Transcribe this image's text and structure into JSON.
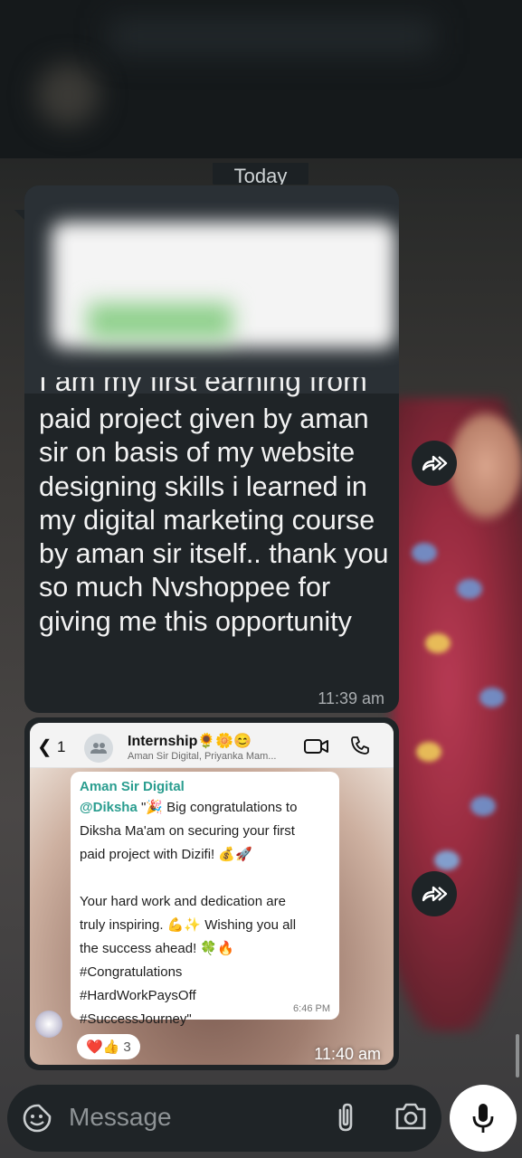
{
  "date_chip": "Today",
  "message": {
    "cut_line": "I am my first earning from",
    "text": "paid project given by aman sir on basis of my website designing skills i learned in my digital marketing course by aman sir itself.. thank you so much Nvshoppee for giving me this opportunity",
    "time": "11:39 am"
  },
  "screenshot_message": {
    "time": "11:40 am",
    "back_count": "1",
    "group_name": "Internship",
    "group_emoji": "🌻🌼😊",
    "members": "Aman Sir Digital, Priyanka Mam...",
    "card": {
      "sender": "Aman Sir Digital",
      "mention": "@Diksha",
      "line1_rest": " \"🎉 Big congratulations to",
      "line2": "Diksha Ma'am on securing your first",
      "line3": "paid project with Dizifi! 💰🚀",
      "line4": "Your hard work and dedication are",
      "line5": "truly inspiring. 💪✨ Wishing you all",
      "line6": "the success ahead! 🍀🔥",
      "line7": "#Congratulations",
      "line8": "#HardWorkPaysOff",
      "line9": "#SuccessJourney\"",
      "time": "6:46 PM"
    },
    "reactions": {
      "emojis": "❤️👍",
      "count": "3"
    }
  },
  "composer": {
    "placeholder": "Message"
  },
  "icons": {
    "forward": "forward-icon",
    "emoji": "sticker-icon",
    "attach": "paperclip-icon",
    "camera": "camera-icon",
    "mic": "mic-icon"
  },
  "colors": {
    "bubble": "#1f2427",
    "accent_green": "#2a9d8f"
  }
}
